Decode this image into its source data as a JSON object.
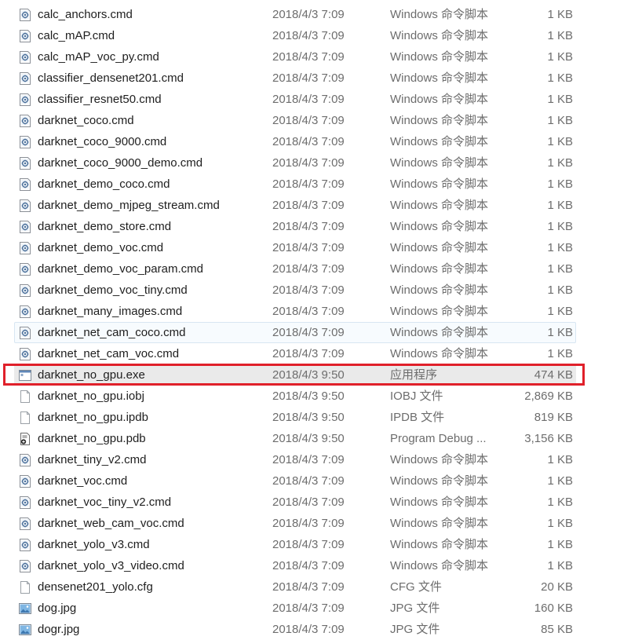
{
  "colors": {
    "highlight": "#e0202a",
    "hover_bg": "#f7fbfe",
    "selected_bg": "#eaeaea",
    "meta_text": "#6d6d6d"
  },
  "files": [
    {
      "name": "calc_anchors.cmd",
      "date": "2018/4/3 7:09",
      "type": "Windows 命令脚本",
      "size": "1 KB",
      "icon": "cmd-script-icon"
    },
    {
      "name": "calc_mAP.cmd",
      "date": "2018/4/3 7:09",
      "type": "Windows 命令脚本",
      "size": "1 KB",
      "icon": "cmd-script-icon"
    },
    {
      "name": "calc_mAP_voc_py.cmd",
      "date": "2018/4/3 7:09",
      "type": "Windows 命令脚本",
      "size": "1 KB",
      "icon": "cmd-script-icon"
    },
    {
      "name": "classifier_densenet201.cmd",
      "date": "2018/4/3 7:09",
      "type": "Windows 命令脚本",
      "size": "1 KB",
      "icon": "cmd-script-icon"
    },
    {
      "name": "classifier_resnet50.cmd",
      "date": "2018/4/3 7:09",
      "type": "Windows 命令脚本",
      "size": "1 KB",
      "icon": "cmd-script-icon"
    },
    {
      "name": "darknet_coco.cmd",
      "date": "2018/4/3 7:09",
      "type": "Windows 命令脚本",
      "size": "1 KB",
      "icon": "cmd-script-icon"
    },
    {
      "name": "darknet_coco_9000.cmd",
      "date": "2018/4/3 7:09",
      "type": "Windows 命令脚本",
      "size": "1 KB",
      "icon": "cmd-script-icon"
    },
    {
      "name": "darknet_coco_9000_demo.cmd",
      "date": "2018/4/3 7:09",
      "type": "Windows 命令脚本",
      "size": "1 KB",
      "icon": "cmd-script-icon"
    },
    {
      "name": "darknet_demo_coco.cmd",
      "date": "2018/4/3 7:09",
      "type": "Windows 命令脚本",
      "size": "1 KB",
      "icon": "cmd-script-icon"
    },
    {
      "name": "darknet_demo_mjpeg_stream.cmd",
      "date": "2018/4/3 7:09",
      "type": "Windows 命令脚本",
      "size": "1 KB",
      "icon": "cmd-script-icon"
    },
    {
      "name": "darknet_demo_store.cmd",
      "date": "2018/4/3 7:09",
      "type": "Windows 命令脚本",
      "size": "1 KB",
      "icon": "cmd-script-icon"
    },
    {
      "name": "darknet_demo_voc.cmd",
      "date": "2018/4/3 7:09",
      "type": "Windows 命令脚本",
      "size": "1 KB",
      "icon": "cmd-script-icon"
    },
    {
      "name": "darknet_demo_voc_param.cmd",
      "date": "2018/4/3 7:09",
      "type": "Windows 命令脚本",
      "size": "1 KB",
      "icon": "cmd-script-icon"
    },
    {
      "name": "darknet_demo_voc_tiny.cmd",
      "date": "2018/4/3 7:09",
      "type": "Windows 命令脚本",
      "size": "1 KB",
      "icon": "cmd-script-icon"
    },
    {
      "name": "darknet_many_images.cmd",
      "date": "2018/4/3 7:09",
      "type": "Windows 命令脚本",
      "size": "1 KB",
      "icon": "cmd-script-icon"
    },
    {
      "name": "darknet_net_cam_coco.cmd",
      "date": "2018/4/3 7:09",
      "type": "Windows 命令脚本",
      "size": "1 KB",
      "icon": "cmd-script-icon",
      "state": "hover"
    },
    {
      "name": "darknet_net_cam_voc.cmd",
      "date": "2018/4/3 7:09",
      "type": "Windows 命令脚本",
      "size": "1 KB",
      "icon": "cmd-script-icon"
    },
    {
      "name": "darknet_no_gpu.exe",
      "date": "2018/4/3 9:50",
      "type": "应用程序",
      "size": "474 KB",
      "icon": "exe-app-icon",
      "state": "selected"
    },
    {
      "name": "darknet_no_gpu.iobj",
      "date": "2018/4/3 9:50",
      "type": "IOBJ 文件",
      "size": "2,869 KB",
      "icon": "blank-file-icon"
    },
    {
      "name": "darknet_no_gpu.ipdb",
      "date": "2018/4/3 9:50",
      "type": "IPDB 文件",
      "size": "819 KB",
      "icon": "blank-file-icon"
    },
    {
      "name": "darknet_no_gpu.pdb",
      "date": "2018/4/3 9:50",
      "type": "Program Debug ...",
      "size": "3,156 KB",
      "icon": "pdb-file-icon"
    },
    {
      "name": "darknet_tiny_v2.cmd",
      "date": "2018/4/3 7:09",
      "type": "Windows 命令脚本",
      "size": "1 KB",
      "icon": "cmd-script-icon"
    },
    {
      "name": "darknet_voc.cmd",
      "date": "2018/4/3 7:09",
      "type": "Windows 命令脚本",
      "size": "1 KB",
      "icon": "cmd-script-icon"
    },
    {
      "name": "darknet_voc_tiny_v2.cmd",
      "date": "2018/4/3 7:09",
      "type": "Windows 命令脚本",
      "size": "1 KB",
      "icon": "cmd-script-icon"
    },
    {
      "name": "darknet_web_cam_voc.cmd",
      "date": "2018/4/3 7:09",
      "type": "Windows 命令脚本",
      "size": "1 KB",
      "icon": "cmd-script-icon"
    },
    {
      "name": "darknet_yolo_v3.cmd",
      "date": "2018/4/3 7:09",
      "type": "Windows 命令脚本",
      "size": "1 KB",
      "icon": "cmd-script-icon"
    },
    {
      "name": "darknet_yolo_v3_video.cmd",
      "date": "2018/4/3 7:09",
      "type": "Windows 命令脚本",
      "size": "1 KB",
      "icon": "cmd-script-icon"
    },
    {
      "name": "densenet201_yolo.cfg",
      "date": "2018/4/3 7:09",
      "type": "CFG 文件",
      "size": "20 KB",
      "icon": "blank-file-icon"
    },
    {
      "name": "dog.jpg",
      "date": "2018/4/3 7:09",
      "type": "JPG 文件",
      "size": "160 KB",
      "icon": "image-file-icon"
    },
    {
      "name": "dogr.jpg",
      "date": "2018/4/3 7:09",
      "type": "JPG 文件",
      "size": "85 KB",
      "icon": "image-file-icon"
    }
  ]
}
